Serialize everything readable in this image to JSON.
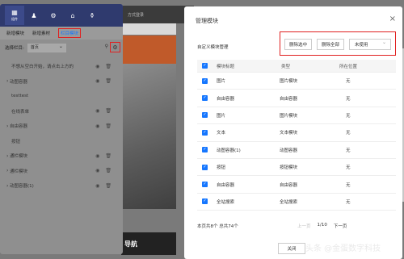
{
  "background": {
    "topbar_text": "方式登录",
    "banner_text": "导航"
  },
  "left_panel": {
    "toolbar": [
      {
        "icon": "grid-icon",
        "label": "组件",
        "glyph": "▦"
      },
      {
        "icon": "shirt-icon",
        "label": "",
        "glyph": "♟"
      },
      {
        "icon": "gear-icon",
        "label": "",
        "glyph": "⚙"
      },
      {
        "icon": "home-icon",
        "label": "",
        "glyph": "⌂"
      },
      {
        "icon": "bag-icon",
        "label": "",
        "glyph": "⚱"
      }
    ],
    "tabs": [
      "新增模块",
      "新增素材",
      "栏目模块"
    ],
    "active_tab": "栏目模块",
    "column_label": "选择栏目:",
    "column_value": "首页",
    "modules": [
      {
        "label": "不想从空白开始，请点击上方的",
        "caret": false
      },
      {
        "label": "动图容器",
        "caret": true
      },
      {
        "label": "testtest",
        "caret": false
      },
      {
        "label": "在线表单",
        "caret": false
      },
      {
        "label": "自由容器",
        "caret": true
      },
      {
        "label": "按钮",
        "caret": false
      },
      {
        "label": "通栏模块",
        "caret": true
      },
      {
        "label": "通栏模块",
        "caret": true
      },
      {
        "label": "动图容器(1)",
        "caret": true
      }
    ]
  },
  "dialog": {
    "title": "管理模块",
    "close": "×",
    "subtitle": "自定义模块管理",
    "btn_delete_selected": "删除选中",
    "btn_delete_all": "删除全部",
    "btn_unused": "未使用",
    "table": {
      "headers": [
        "模块标题",
        "类型",
        "所在位置"
      ],
      "rows": [
        [
          "图片",
          "图片模块",
          "无"
        ],
        [
          "自由容器",
          "自由容器",
          "无"
        ],
        [
          "图片",
          "图片模块",
          "无"
        ],
        [
          "文本",
          "文本模块",
          "无"
        ],
        [
          "动图容器(1)",
          "动图容器",
          "无"
        ],
        [
          "按钮",
          "按钮模块",
          "无"
        ],
        [
          "自由容器",
          "自由容器",
          "无"
        ],
        [
          "全站搜索",
          "全站搜索",
          "无"
        ]
      ]
    },
    "pager_info": "本页共8个  总共74个",
    "pager_prev": "上一页",
    "pager_page": "1/10",
    "pager_next": "下一页",
    "close_button": "关闭"
  },
  "watermark": "头条 @金蛋数字科技",
  "colors": {
    "accent": "#1677ff",
    "highlight": "#e02020",
    "toolbar": "#2f3a6e"
  }
}
